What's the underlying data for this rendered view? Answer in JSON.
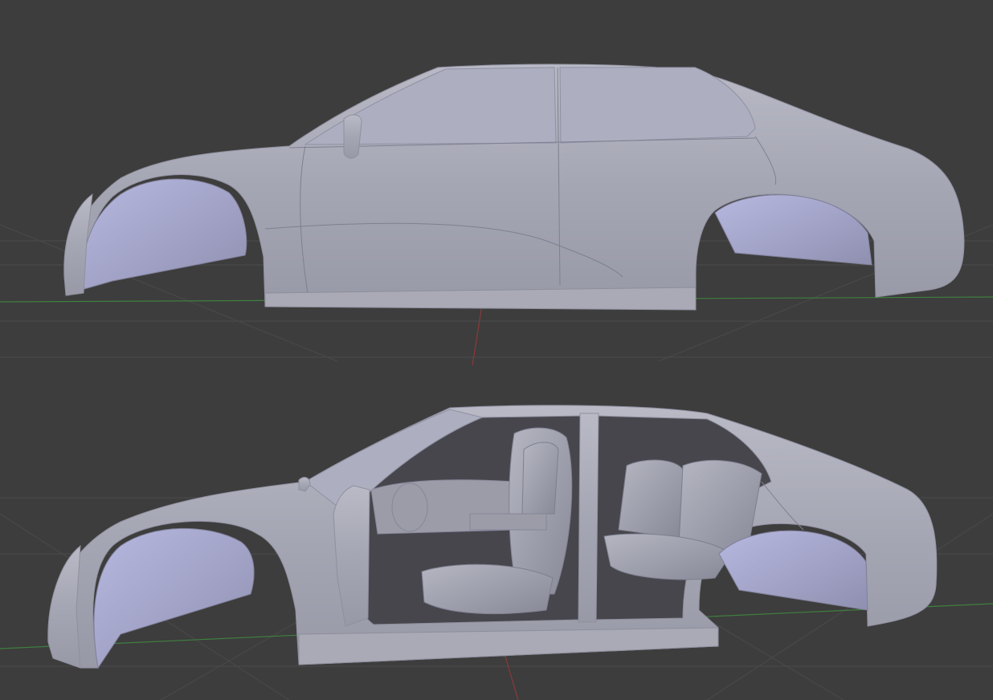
{
  "viewport": {
    "background": "#3d3d3d",
    "grid_color": "#4a4a4a",
    "x_axis_color": "#3f7f3f",
    "y_axis_color": "#8a3a3a"
  },
  "scene": {
    "objects": [
      {
        "name": "car-body-closed",
        "material_color": "#a6a7b5"
      },
      {
        "name": "car-body-open-doors-with-interior",
        "material_color": "#a6a7b5"
      }
    ]
  }
}
